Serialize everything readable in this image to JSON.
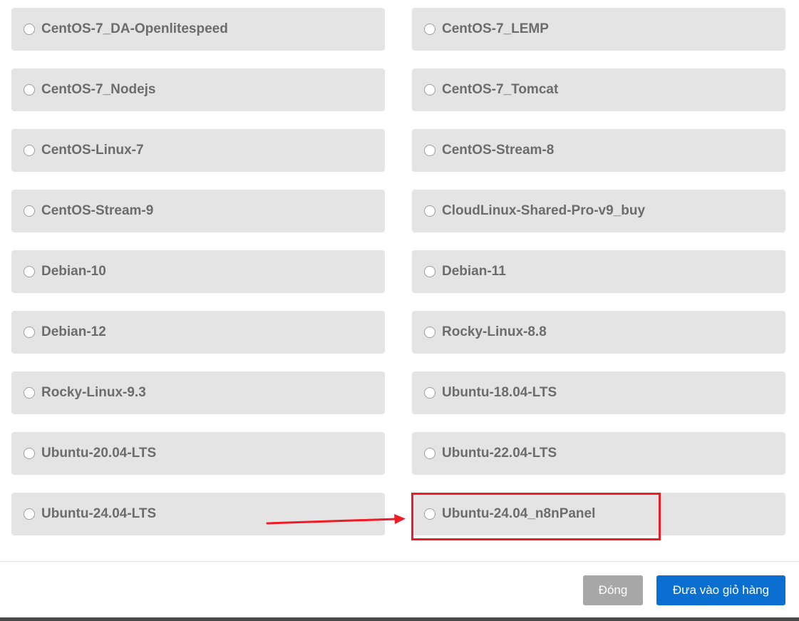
{
  "os_options": [
    {
      "label": "CentOS-7_DA-Openlitespeed",
      "selected": false
    },
    {
      "label": "CentOS-7_LEMP",
      "selected": false
    },
    {
      "label": "CentOS-7_Nodejs",
      "selected": false
    },
    {
      "label": "CentOS-7_Tomcat",
      "selected": false
    },
    {
      "label": "CentOS-Linux-7",
      "selected": false
    },
    {
      "label": "CentOS-Stream-8",
      "selected": false
    },
    {
      "label": "CentOS-Stream-9",
      "selected": false
    },
    {
      "label": "CloudLinux-Shared-Pro-v9_buy",
      "selected": false
    },
    {
      "label": "Debian-10",
      "selected": false
    },
    {
      "label": "Debian-11",
      "selected": false
    },
    {
      "label": "Debian-12",
      "selected": false
    },
    {
      "label": "Rocky-Linux-8.8",
      "selected": false
    },
    {
      "label": "Rocky-Linux-9.3",
      "selected": false
    },
    {
      "label": "Ubuntu-18.04-LTS",
      "selected": false
    },
    {
      "label": "Ubuntu-20.04-LTS",
      "selected": false
    },
    {
      "label": "Ubuntu-22.04-LTS",
      "selected": false
    },
    {
      "label": "Ubuntu-24.04-LTS",
      "selected": false
    },
    {
      "label": "Ubuntu-24.04_n8nPanel",
      "selected": false,
      "highlighted": true
    }
  ],
  "footer": {
    "close_label": "Đóng",
    "add_to_cart_label": "Đưa vào giỏ hàng"
  },
  "colors": {
    "option_bg": "#e4e4e4",
    "option_text": "#6c6c6c",
    "highlight": "#ee1c25",
    "primary_button": "#0b6fd1",
    "secondary_button": "#a7a7a7"
  },
  "annotation": {
    "icon": "arrow-right-icon",
    "target": "Ubuntu-24.04_n8nPanel"
  }
}
